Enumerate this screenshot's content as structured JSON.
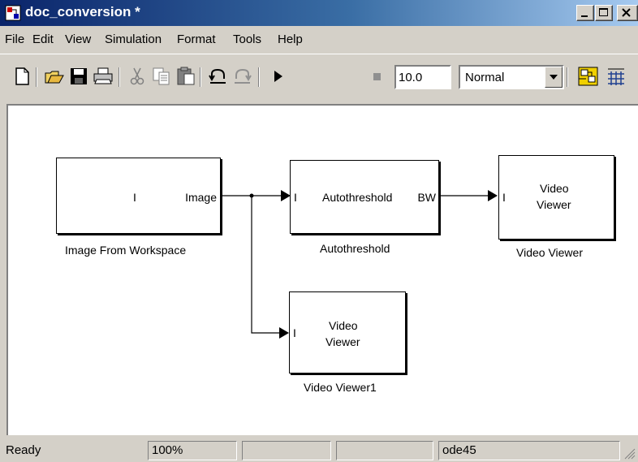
{
  "window": {
    "title": "doc_conversion *"
  },
  "menu": [
    "File",
    "Edit",
    "View",
    "Simulation",
    "Format",
    "Tools",
    "Help"
  ],
  "toolbar": {
    "icons": [
      "new-icon",
      "open-icon",
      "save-icon",
      "print-icon",
      "cut-icon",
      "copy-icon",
      "paste-icon",
      "undo-icon",
      "redo-icon",
      "play-icon",
      "stop-icon",
      "library-browser-icon",
      "model-explorer-icon"
    ],
    "stop_time": "10.0",
    "sim_mode": "Normal"
  },
  "blocks": {
    "image_from_workspace": {
      "port_i": "I",
      "port_out": "Image",
      "label": "Image From Workspace"
    },
    "autothreshold": {
      "port_in": "I",
      "name": "Autothreshold",
      "port_out": "BW",
      "label": "Autothreshold"
    },
    "video_viewer": {
      "port_in": "I",
      "line1": "Video",
      "line2": "Viewer",
      "label": "Video Viewer"
    },
    "video_viewer1": {
      "port_in": "I",
      "line1": "Video",
      "line2": "Viewer",
      "label": "Video Viewer1"
    }
  },
  "status": {
    "state": "Ready",
    "zoom": "100%",
    "solver": "ode45"
  }
}
